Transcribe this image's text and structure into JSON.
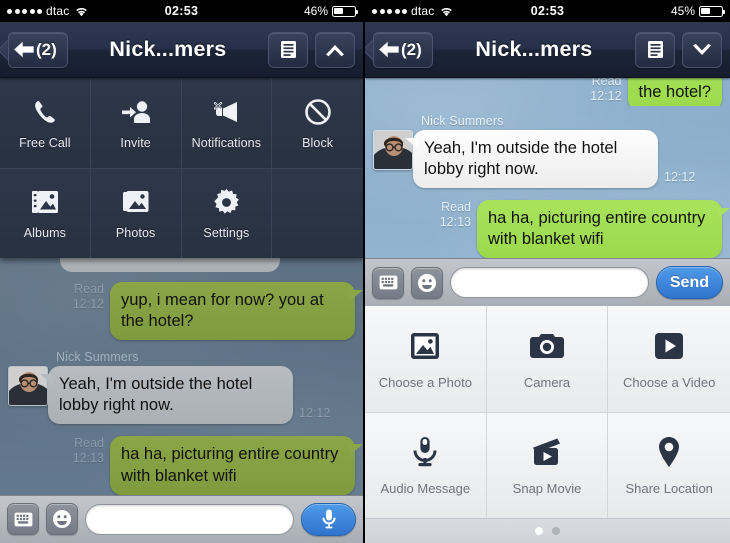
{
  "phones": [
    {
      "id": "left",
      "status_bar": {
        "signal_dots": 5,
        "carrier": "dtac",
        "wifi_icon": "wifi-icon",
        "time": "02:53",
        "battery_percent": "46%",
        "battery_level": 0.46
      },
      "nav_bar": {
        "back_label": "(2)",
        "back_icon": "back-arrow-icon",
        "title": "Nick...mers",
        "menu_icon": "list-menu-icon",
        "toggle_icon": "chevron-up-icon"
      },
      "menu_panel": {
        "items": [
          {
            "label": "Free Call",
            "icon": "phone-icon"
          },
          {
            "label": "Invite",
            "icon": "add-person-icon"
          },
          {
            "label": "Notifications",
            "icon": "mute-megaphone-icon"
          },
          {
            "label": "Block",
            "icon": "block-icon"
          },
          {
            "label": "Albums",
            "icon": "albums-icon"
          },
          {
            "label": "Photos",
            "icon": "photos-icon"
          },
          {
            "label": "Settings",
            "icon": "gear-icon"
          }
        ]
      },
      "messages": [
        {
          "type": "clipped-grey",
          "side": "in",
          "text": ""
        },
        {
          "side": "out",
          "style": "green",
          "text": "yup, i mean for now? you at the hotel?",
          "read": "Read",
          "time": "12:12"
        },
        {
          "side": "in",
          "style": "grey",
          "sender": "Nick Summers",
          "text": "Yeah, I'm outside the hotel lobby right now.",
          "time": "12:12",
          "avatar": "contact-avatar"
        },
        {
          "side": "out",
          "style": "green",
          "text": "ha ha, picturing entire country with blanket wifi",
          "read": "Read",
          "time": "12:13"
        }
      ],
      "input_bar": {
        "keyboard_icon": "keyboard-icon",
        "emoji_icon": "smiley-icon",
        "text_value": "",
        "placeholder": "",
        "action_icon": "microphone-icon",
        "action_kind": "mic"
      }
    },
    {
      "id": "right",
      "status_bar": {
        "signal_dots": 5,
        "carrier": "dtac",
        "wifi_icon": "wifi-icon",
        "time": "02:53",
        "battery_percent": "45%",
        "battery_level": 0.45
      },
      "nav_bar": {
        "back_label": "(2)",
        "back_icon": "back-arrow-icon",
        "title": "Nick...mers",
        "menu_icon": "list-menu-icon",
        "toggle_icon": "chevron-down-icon"
      },
      "messages": [
        {
          "side": "out",
          "style": "green",
          "text": "the hotel?",
          "read": "Read",
          "time": "12:12",
          "clipped": true
        },
        {
          "side": "in",
          "style": "grey",
          "sender": "Nick Summers",
          "text": "Yeah, I'm outside the hotel lobby right now.",
          "time": "12:12",
          "avatar": "contact-avatar"
        },
        {
          "side": "out",
          "style": "green",
          "text": "ha ha, picturing entire country with blanket wifi",
          "read": "Read",
          "time": "12:13"
        }
      ],
      "input_bar": {
        "keyboard_icon": "keyboard-icon",
        "emoji_icon": "smiley-icon",
        "text_value": "",
        "placeholder": "",
        "action_label": "Send",
        "action_kind": "send"
      },
      "attachment_panel": {
        "items": [
          {
            "label": "Choose a Photo",
            "icon": "photo-icon"
          },
          {
            "label": "Camera",
            "icon": "camera-icon"
          },
          {
            "label": "Choose a Video",
            "icon": "play-video-icon"
          },
          {
            "label": "Audio Message",
            "icon": "microphone-icon"
          },
          {
            "label": "Snap Movie",
            "icon": "clapperboard-icon"
          },
          {
            "label": "Share Location",
            "icon": "map-pin-icon"
          }
        ],
        "pages": 2,
        "active_page": 1
      }
    }
  ],
  "colors": {
    "navbar_dark": "#26304a",
    "menu_panel": "#2b3446",
    "bubble_green_bright": "#a9e35d",
    "bubble_green_dim": "#8aa647",
    "bubble_grey_bright": "#fdfdfd",
    "bubble_grey_dim": "#b8bcc0",
    "accent_blue": "#2f74cf",
    "wallpaper_left": "#5b6f84",
    "wallpaper_right": "#89acca"
  }
}
